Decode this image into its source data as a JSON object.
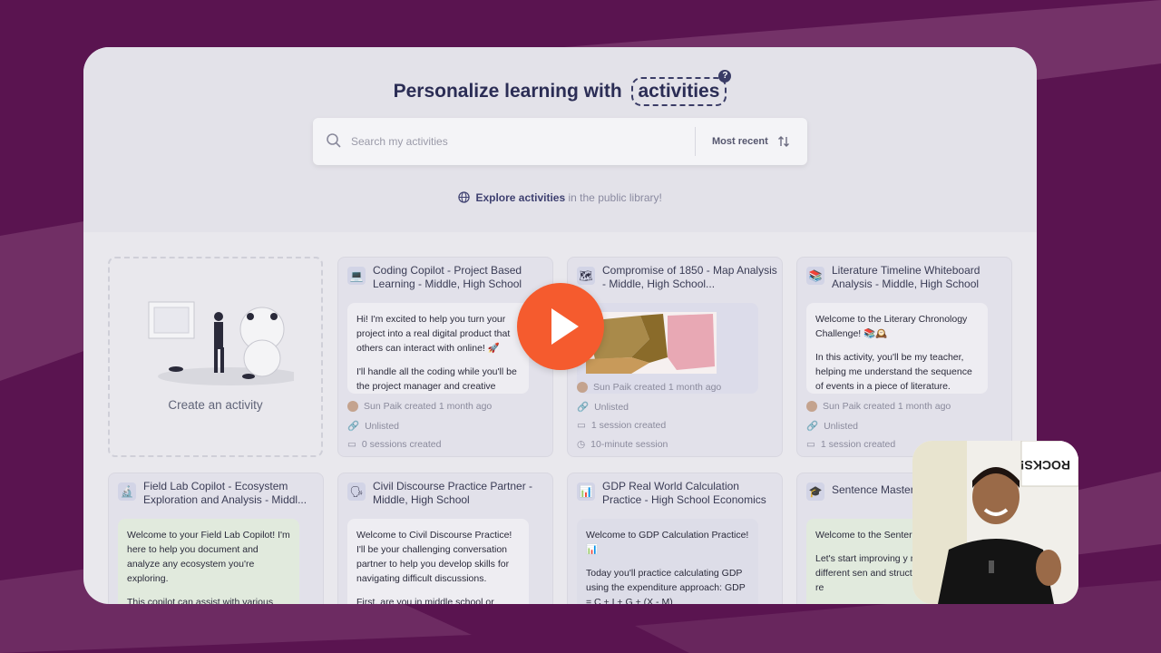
{
  "header": {
    "title_prefix": "Personalize learning with",
    "title_highlight": "activities",
    "help_badge": "?"
  },
  "search": {
    "placeholder": "Search my activities",
    "value": "",
    "sort_label": "Most recent"
  },
  "explore": {
    "link": "Explore activities",
    "suffix": "in the public library!"
  },
  "create": {
    "label": "Create an activity"
  },
  "cards": [
    {
      "icon": "laptop-icon",
      "title": "Coding Copilot - Project Based Learning - Middle, High School",
      "bubble": [
        "Hi! I'm excited to help you turn your project into a real digital product that others can interact with online! 🚀",
        "I'll handle all the coding while you'll be the project manager and creative"
      ],
      "meta": [
        "Sun Paik created 1 month ago",
        "Unlisted",
        "0 sessions created"
      ]
    },
    {
      "icon": "map-icon",
      "title": "Compromise of 1850 - Map Analysis - Middle, High School...",
      "bubble": [],
      "meta": [
        "Sun Paik created 1 month ago",
        "Unlisted",
        "1 session created",
        "10-minute session"
      ]
    },
    {
      "icon": "books-icon",
      "title": "Literature Timeline Whiteboard Analysis - Middle, High School",
      "bubble": [
        "Welcome to the Literary Chronology Challenge! 📚🕰️",
        "In this activity, you'll be my teacher, helping me understand the sequence of events in a piece of literature."
      ],
      "meta": [
        "Sun Paik created 1 month ago",
        "Unlisted",
        "1 session created"
      ]
    },
    {
      "icon": "microscope-icon",
      "title": "Field Lab Copilot - Ecosystem Exploration and Analysis - Middl...",
      "bubble": [
        "Welcome to your Field Lab Copilot! I'm here to help you document and analyze any ecosystem you're exploring.",
        "This copilot can assist with various"
      ]
    },
    {
      "icon": "speech-head-icon",
      "title": "Civil Discourse Practice Partner - Middle, High School",
      "bubble": [
        "Welcome to Civil Discourse Practice! I'll be your challenging conversation partner to help you develop skills for navigating difficult discussions.",
        "First, are you in middle school or"
      ]
    },
    {
      "icon": "bar-chart-icon",
      "title": "GDP Real World Calculation Practice - High School Economics",
      "bubble": [
        "Welcome to GDP Calculation Practice! 📊",
        "Today you'll practice calculating GDP using the expenditure approach: GDP = C + I + G + (X - M)"
      ]
    },
    {
      "icon": "grad-cap-icon",
      "title": "Sentence Master",
      "bubble": [
        "Welcome to the Senter Challenge! 🎓",
        "Let's start improving y mastering different sen and structures. Are you re"
      ]
    }
  ],
  "colors": {
    "accent": "#f55b2e",
    "brand_bg": "#5a1450",
    "heading": "#2b2d55"
  }
}
